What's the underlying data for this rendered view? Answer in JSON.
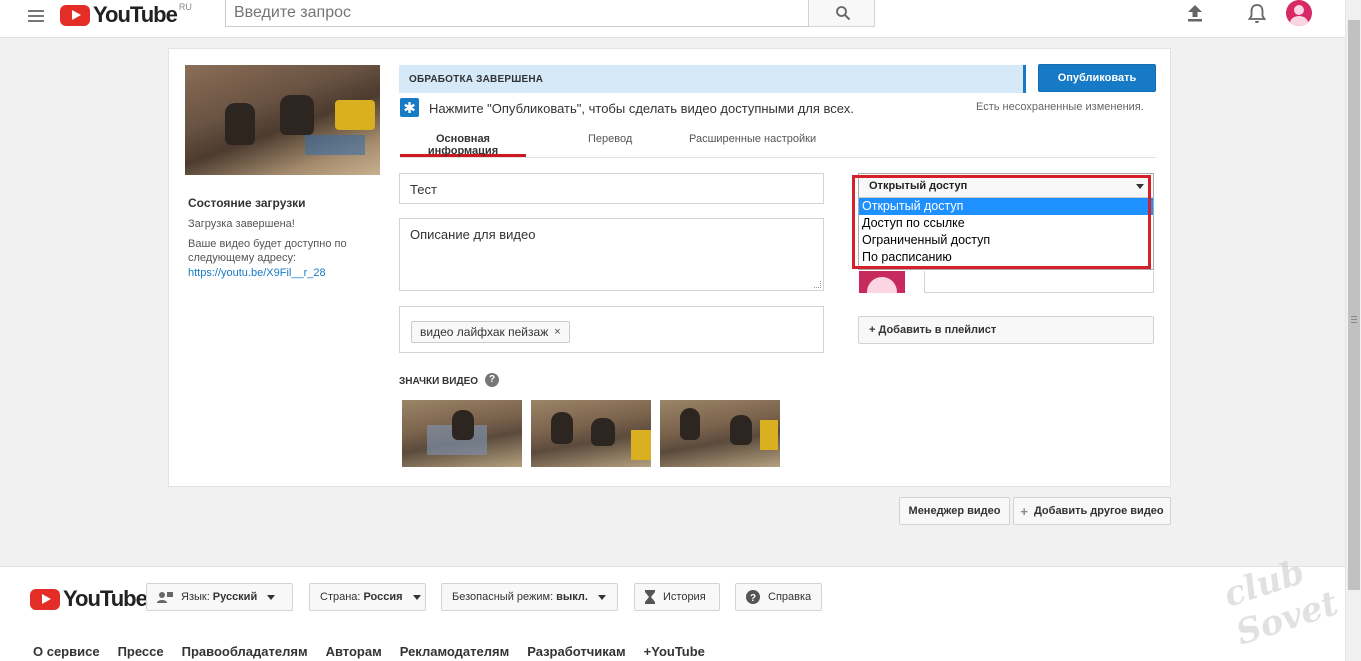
{
  "header": {
    "logo_text": "YouTube",
    "logo_region": "RU",
    "search_placeholder": "Введите запрос",
    "icons": [
      "menu-icon",
      "search-icon",
      "upload-icon",
      "bell-icon",
      "avatar"
    ]
  },
  "sidebar": {
    "status_title": "Состояние загрузки",
    "status_text": "Загрузка завершена!",
    "address_text": "Ваше видео будет доступно по следующему адресу:",
    "link": "https://youtu.be/X9Fil__r_28"
  },
  "processing": {
    "banner": "ОБРАБОТКА ЗАВЕРШЕНА",
    "publish_label": "Опубликовать",
    "hint": "Нажмите \"Опубликовать\", чтобы сделать видео доступными для всех.",
    "unsaved": "Есть несохраненные изменения."
  },
  "tabs": [
    {
      "label": "Основная информация",
      "active": true
    },
    {
      "label": "Перевод",
      "active": false
    },
    {
      "label": "Расширенные настройки",
      "active": false
    }
  ],
  "form": {
    "title_value": "Тест",
    "description_value": "Описание для видео",
    "tags": [
      {
        "label": "видео лайфхак пейзаж"
      }
    ],
    "tag_remove": "×"
  },
  "thumbnails": {
    "label": "ЗНАЧКИ ВИДЕО",
    "help": "?"
  },
  "privacy": {
    "selected": "Открытый доступ",
    "options": [
      "Открытый доступ",
      "Доступ по ссылке",
      "Ограниченный доступ",
      "По расписанию"
    ],
    "highlight_color": "#d4202a"
  },
  "playlist": {
    "label": "+ Добавить в плейлист"
  },
  "actions": {
    "manager_label": "Менеджер видео",
    "add_label": "Добавить другое видео",
    "add_plus": "+"
  },
  "footer": {
    "logo_text": "YouTube",
    "lang_prefix": "Язык:",
    "lang_value": "Русский",
    "country_prefix": "Страна:",
    "country_value": "Россия",
    "safe_prefix": "Безопасный режим:",
    "safe_value": "выкл.",
    "history_label": "История",
    "help_label": "Справка",
    "links": [
      "О сервисе",
      "Прессе",
      "Правообладателям",
      "Авторам",
      "Рекламодателям",
      "Разработчикам",
      "+YouTube"
    ]
  },
  "colors": {
    "brand_red": "#e52d27",
    "accent_blue": "#167ac6"
  }
}
